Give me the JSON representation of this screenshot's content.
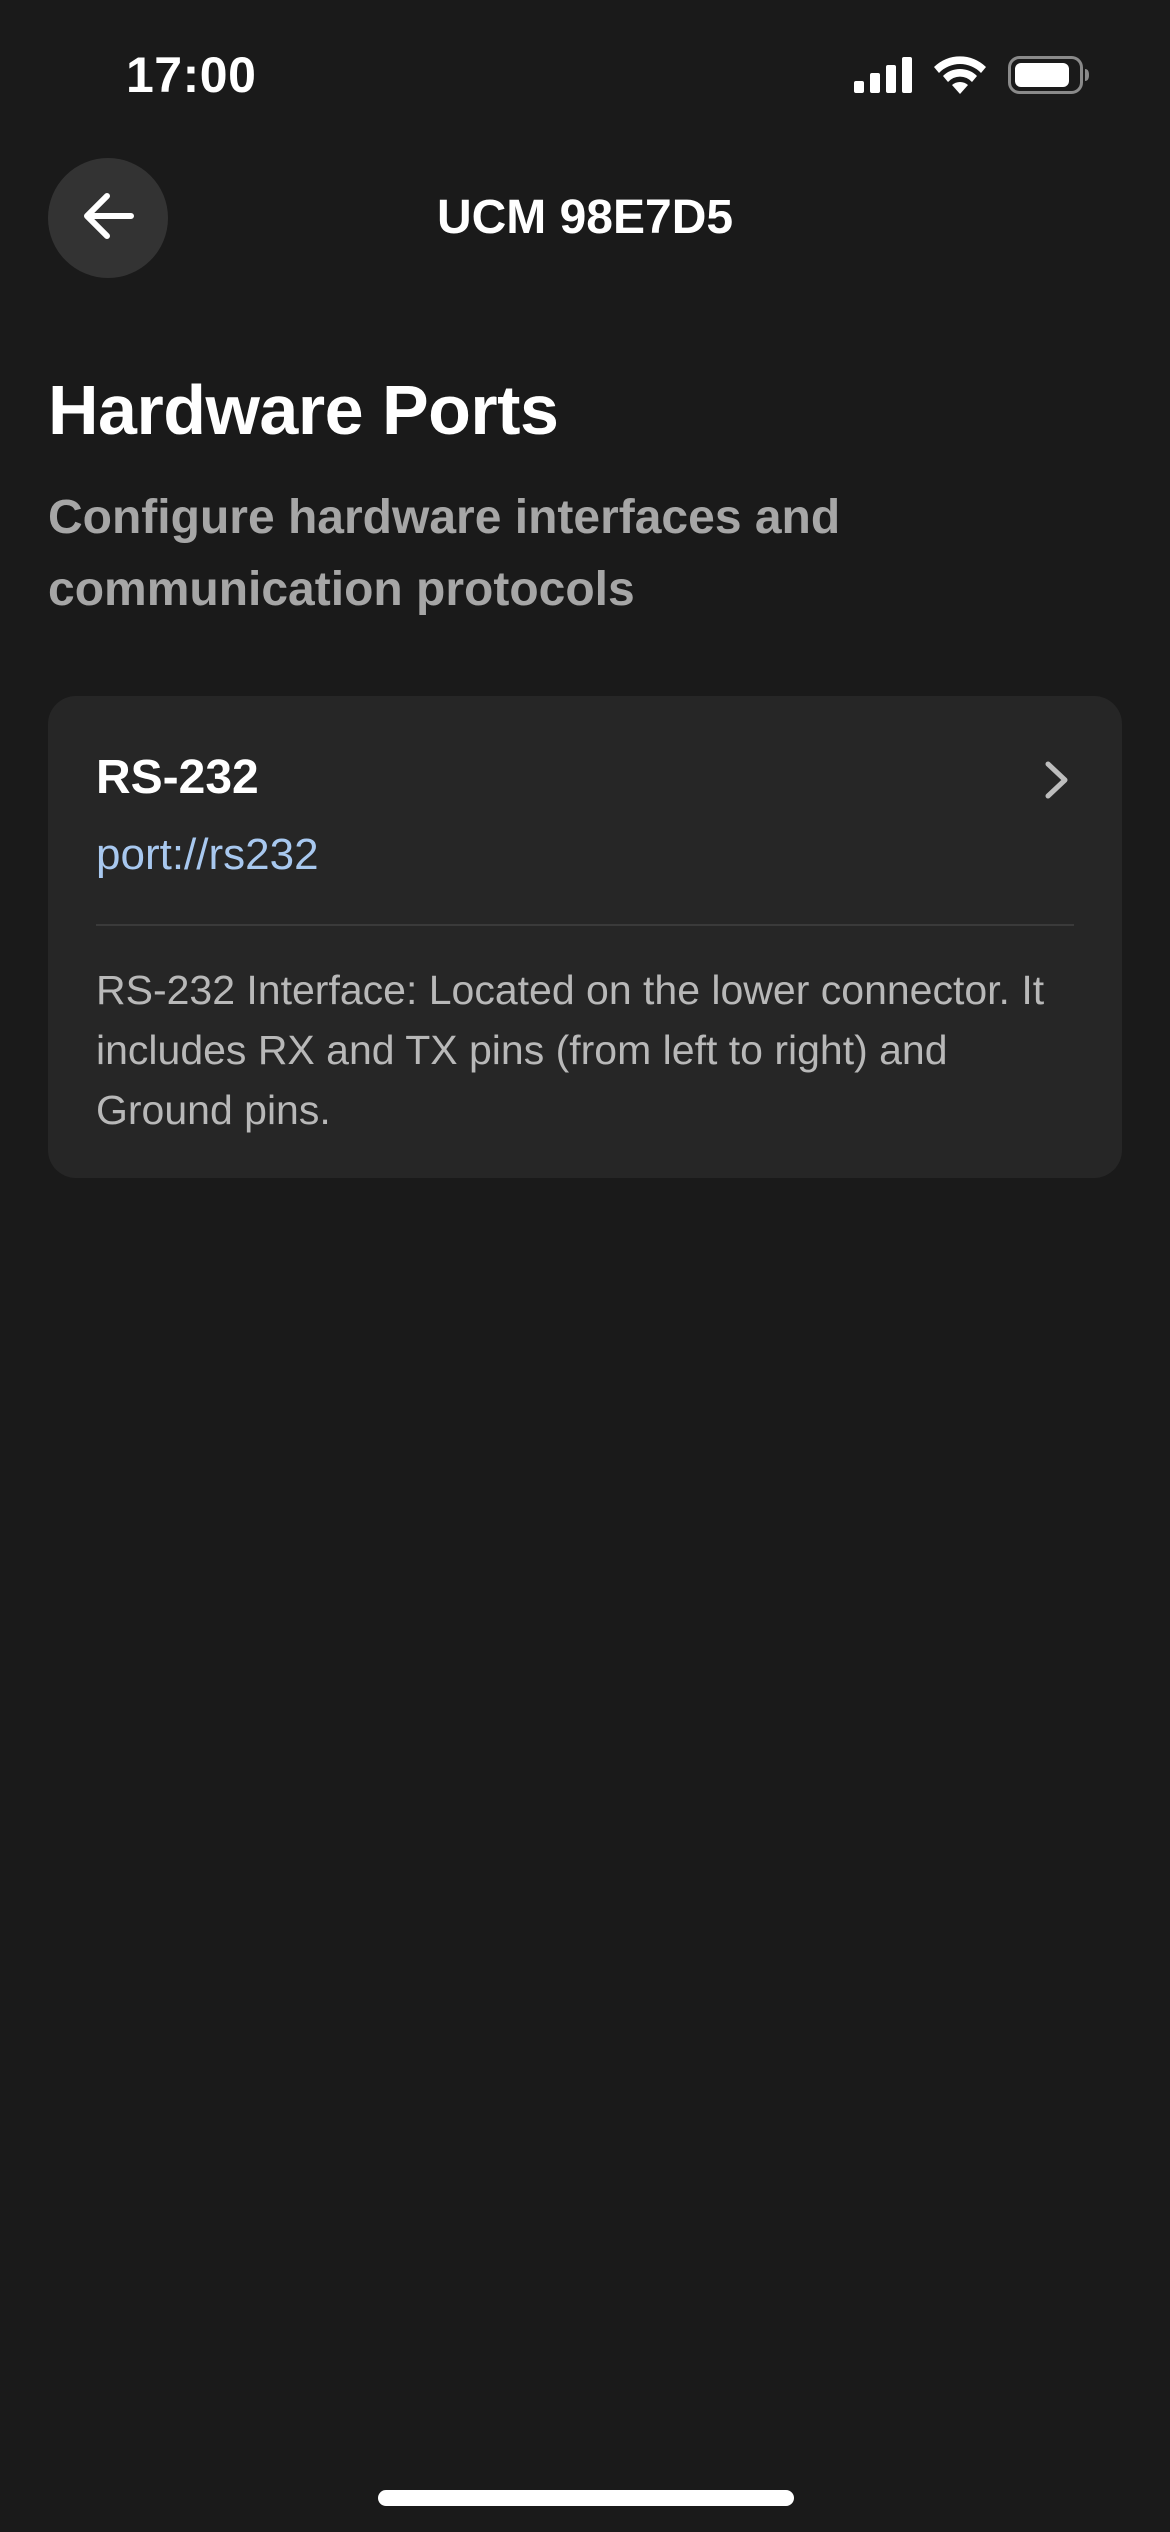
{
  "status_bar": {
    "time": "17:00",
    "icons": [
      "cellular-signal-icon",
      "wifi-icon",
      "battery-icon"
    ]
  },
  "nav": {
    "back_icon": "arrow-left-icon",
    "title": "UCM 98E7D5"
  },
  "header": {
    "title": "Hardware Ports",
    "subtitle": "Configure hardware interfaces and communication protocols"
  },
  "ports": [
    {
      "name": "RS-232",
      "uri": "port://rs232",
      "description": "RS-232 Interface: Located on the lower connector. It includes RX and TX pins (from left to right) and Ground pins.",
      "chevron_icon": "chevron-right-icon"
    }
  ],
  "colors": {
    "background": "#1a1a1a",
    "card": "#262626",
    "accent_link": "#a8c8ef",
    "secondary_text": "#a6a6a6"
  }
}
